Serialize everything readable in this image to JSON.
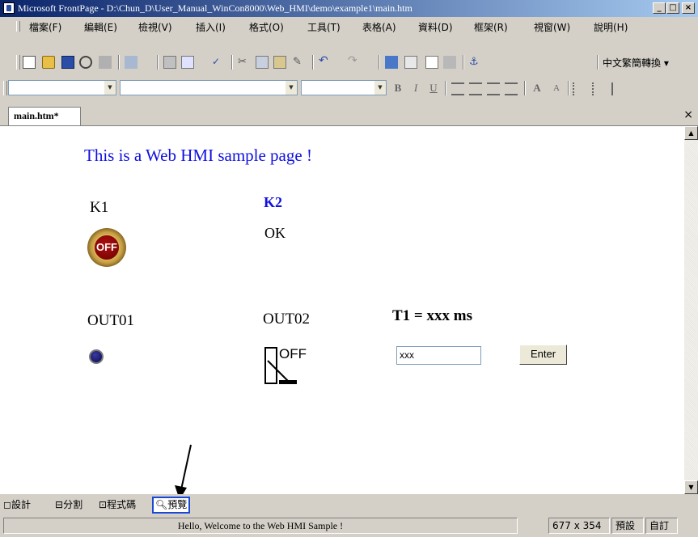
{
  "window": {
    "title": "Microsoft FrontPage - D:\\Chun_D\\User_Manual_WinCon8000\\Web_HMI\\demo\\example1\\main.htm",
    "minimize": "_",
    "maximize": "□",
    "close": "×"
  },
  "menu": [
    "檔案(F)",
    "編輯(E)",
    "檢視(V)",
    "插入(I)",
    "格式(O)",
    "工具(T)",
    "表格(A)",
    "資料(D)",
    "框架(R)",
    "視窗(W)",
    "說明(H)"
  ],
  "toolbar": {
    "conversion_label": "中文繁簡轉換 ▾"
  },
  "format_toolbar": {
    "bold": "B",
    "italic": "I",
    "underline": "U",
    "grow_font": "A",
    "shrink_font": "A"
  },
  "document": {
    "tab_label": "main.htm*",
    "close_tab": "×",
    "heading": "This is a Web HMI sample page !",
    "k1_label": "K1",
    "k2_label": "K2",
    "ok_text": "OK",
    "off_button_text": "OFF",
    "out01_label": "OUT01",
    "out02_label": "OUT02",
    "switch_text": "OFF",
    "t1_prefix": "T1 = ",
    "t1_value": "xxx ms",
    "t1_input_value": "xxx",
    "enter_button": "Enter"
  },
  "view_tabs": [
    "設計",
    "分割",
    "程式碼",
    "預覽"
  ],
  "status": {
    "message": "Hello, Welcome to the Web HMI Sample !",
    "page_size": "677 x 354",
    "mode": "預設",
    "custom": "自訂"
  },
  "colors": {
    "title_gradient_start": "#0a246a",
    "heading_blue": "#1010e0",
    "selected_tab_border": "#1848d8"
  }
}
